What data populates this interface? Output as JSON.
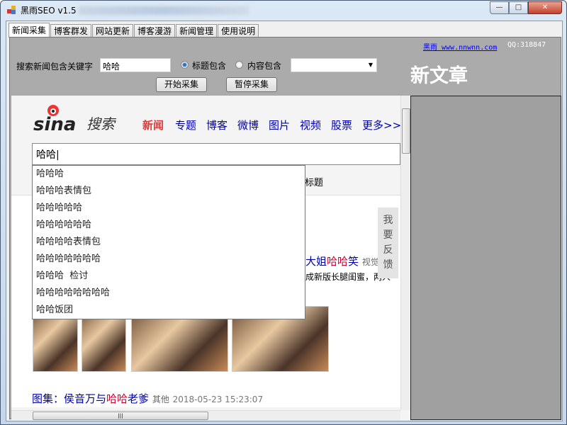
{
  "window": {
    "title": "黑雨SEO v1.5",
    "minimize": "—",
    "maximize": "□",
    "close": "✕"
  },
  "tabs": [
    "新闻采集",
    "博客群发",
    "网站更新",
    "博客漫游",
    "新闻管理",
    "使用说明"
  ],
  "form": {
    "keyword_label": "搜索新闻包含关键字",
    "keyword_value": "哈哈",
    "radio_title": "标题包含",
    "radio_content": "内容包含",
    "start_button": "开始采集",
    "pause_button": "暂停采集"
  },
  "header": {
    "link": "黑雨 www.nnwnn.com",
    "qq": "QQ:318847",
    "new_article": "新文章"
  },
  "browser": {
    "logo_text": "sina",
    "logo_search": "搜索",
    "nav": [
      "新闻",
      "专题",
      "博客",
      "微博",
      "图片",
      "视频",
      "股票",
      "更多>>"
    ],
    "search_value": "哈哈",
    "suggestions": [
      "哈哈哈",
      "哈哈哈表情包",
      "哈哈哈哈哈",
      "哈哈哈哈哈哈",
      "哈哈哈哈表情包",
      "哈哈哈哈哈哈哈",
      "哈哈哈  检讨",
      "哈哈哈哈哈哈哈哈",
      "哈哈饭团"
    ],
    "behind_label": "标题",
    "behind_title_a": "大姐",
    "behind_title_red": "哈哈",
    "behind_title_b": "笑",
    "behind_source": "视觉",
    "behind_snippet": "成新版长腿闺蜜，两人",
    "feedback": "我要反馈",
    "result2": {
      "prefix": "图集：侯音万与",
      "red": "哈哈",
      "suffix": "老爹",
      "source": "其他",
      "time": "2018-05-23 15:23:07"
    }
  }
}
